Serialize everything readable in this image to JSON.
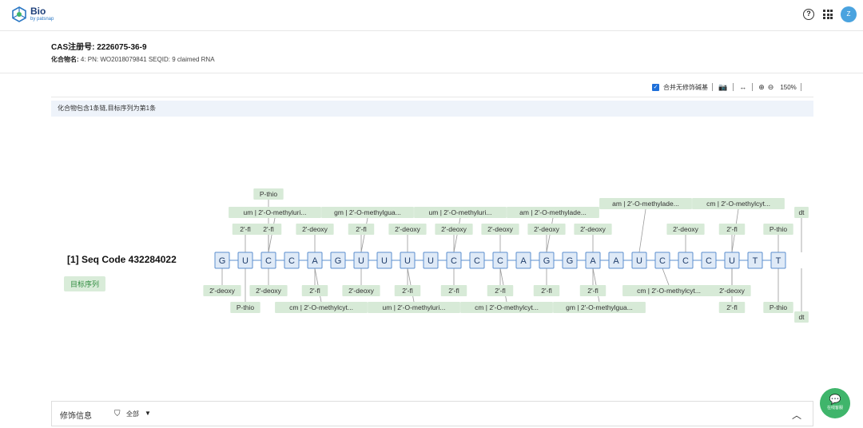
{
  "app": {
    "name": "Bio",
    "subtitle": "by patsnap",
    "avatar": "Z"
  },
  "compound": {
    "cas_label": "CAS注册号:",
    "cas_value": "2226075-36-9",
    "name_label": "化合物名:",
    "name_value": "4: PN: WO2018079841 SEQID: 9 claimed RNA"
  },
  "toolbar": {
    "merge_label": "合并无修饰碱基",
    "zoom": "150%"
  },
  "info_text": "化合物包含1条链,目标序列为第1条",
  "sequence": {
    "title": "[1] Seq Code 432284022",
    "badge": "目标序列",
    "bases": [
      "G",
      "U",
      "C",
      "C",
      "A",
      "G",
      "U",
      "U",
      "U",
      "U",
      "C",
      "C",
      "C",
      "A",
      "G",
      "G",
      "A",
      "A",
      "U",
      "C",
      "C",
      "C",
      "U",
      "T",
      "T"
    ]
  },
  "annotations": [
    {
      "text": "P-thio",
      "base": 2,
      "side": "up",
      "row": 4
    },
    {
      "text": "um | 2'-O-methyluri...",
      "base": 2,
      "side": "up",
      "row": 3
    },
    {
      "text": "gm | 2'-O-methylgua...",
      "base": 6,
      "side": "up",
      "row": 3
    },
    {
      "text": "um | 2'-O-methyluri...",
      "base": 10,
      "side": "up",
      "row": 3
    },
    {
      "text": "am | 2'-O-methylade...",
      "base": 14,
      "side": "up",
      "row": 3
    },
    {
      "text": "am | 2'-O-methylade...",
      "base": 18,
      "side": "up",
      "row": 2
    },
    {
      "text": "cm | 2'-O-methylcyt...",
      "base": 22,
      "side": "up",
      "row": 2
    },
    {
      "text": "dt",
      "base": 25,
      "side": "up",
      "row": 3
    },
    {
      "text": "2'-fl",
      "base": 1,
      "side": "up",
      "row": 1
    },
    {
      "text": "2'-fl",
      "base": 2,
      "side": "up",
      "row": 1
    },
    {
      "text": "2'-deoxy",
      "base": 4,
      "side": "up",
      "row": 1
    },
    {
      "text": "2'-fl",
      "base": 6,
      "side": "up",
      "row": 1
    },
    {
      "text": "2'-deoxy",
      "base": 8,
      "side": "up",
      "row": 1
    },
    {
      "text": "2'-deoxy",
      "base": 10,
      "side": "up",
      "row": 1
    },
    {
      "text": "2'-deoxy",
      "base": 12,
      "side": "up",
      "row": 1
    },
    {
      "text": "2'-deoxy",
      "base": 14,
      "side": "up",
      "row": 1
    },
    {
      "text": "2'-deoxy",
      "base": 16,
      "side": "up",
      "row": 1
    },
    {
      "text": "2'-deoxy",
      "base": 20,
      "side": "up",
      "row": 1
    },
    {
      "text": "2'-fl",
      "base": 22,
      "side": "up",
      "row": 1
    },
    {
      "text": "P-thio",
      "base": 24,
      "side": "up",
      "row": 1
    },
    {
      "text": "2'-deoxy",
      "base": 0,
      "side": "down",
      "row": 1
    },
    {
      "text": "2'-deoxy",
      "base": 2,
      "side": "down",
      "row": 1
    },
    {
      "text": "2'-fl",
      "base": 4,
      "side": "down",
      "row": 1
    },
    {
      "text": "2'-deoxy",
      "base": 6,
      "side": "down",
      "row": 1
    },
    {
      "text": "2'-fl",
      "base": 8,
      "side": "down",
      "row": 1
    },
    {
      "text": "2'-fl",
      "base": 10,
      "side": "down",
      "row": 1
    },
    {
      "text": "2'-fl",
      "base": 12,
      "side": "down",
      "row": 1
    },
    {
      "text": "2'-fl",
      "base": 14,
      "side": "down",
      "row": 1
    },
    {
      "text": "2'-fl",
      "base": 16,
      "side": "down",
      "row": 1
    },
    {
      "text": "cm | 2'-O-methylcyt...",
      "base": 19,
      "side": "down",
      "row": 1
    },
    {
      "text": "2'-deoxy",
      "base": 22,
      "side": "down",
      "row": 1
    },
    {
      "text": "P-thio",
      "base": 1,
      "side": "down",
      "row": 2
    },
    {
      "text": "cm | 2'-O-methylcyt...",
      "base": 4,
      "side": "down",
      "row": 2
    },
    {
      "text": "um | 2'-O-methyluri...",
      "base": 8,
      "side": "down",
      "row": 2
    },
    {
      "text": "cm | 2'-O-methylcyt...",
      "base": 12,
      "side": "down",
      "row": 2
    },
    {
      "text": "gm | 2'-O-methylgua...",
      "base": 16,
      "side": "down",
      "row": 2
    },
    {
      "text": "2'-fl",
      "base": 22,
      "side": "down",
      "row": 2
    },
    {
      "text": "P-thio",
      "base": 24,
      "side": "down",
      "row": 2
    },
    {
      "text": "dt",
      "base": 25,
      "side": "down",
      "row": 3
    }
  ],
  "footer": {
    "label": "修饰信息",
    "filter": "全部"
  },
  "chat": {
    "label": "在线客服"
  },
  "colors": {
    "base_fill": "#dfeaf7",
    "base_stroke": "#5b8fcf",
    "tag_fill": "#d7ead7",
    "line": "#999999"
  }
}
